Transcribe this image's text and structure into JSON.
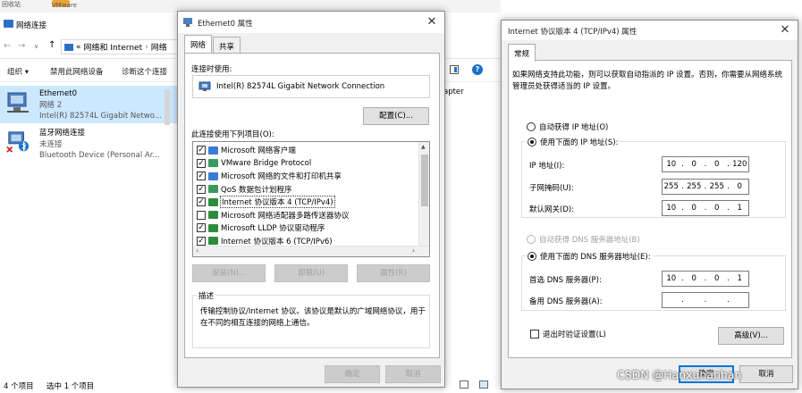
{
  "explorer": {
    "desktop_fragments": [
      "回收站",
      "VMware"
    ],
    "title": "网络连接",
    "breadcrumb": {
      "prefix": "«",
      "items": [
        "网络和 Internet",
        "网络"
      ]
    },
    "commands": [
      "组织 ▾",
      "禁用此网络设备",
      "诊断这个连接"
    ],
    "partial_text": "apter",
    "adapters": [
      {
        "name": "Ethernet0",
        "status": "网络 2",
        "device": "Intel(R) 82574L Gigabit Netwo...",
        "selected": true
      },
      {
        "name": "蓝牙网络连接",
        "status": "未连接",
        "device": "Bluetooth Device (Personal Ar...",
        "selected": false
      }
    ],
    "status_bar": {
      "count": "4 个项目",
      "selected": "选中 1 个项目"
    }
  },
  "props": {
    "title": "Ethernet0 属性",
    "tabs": [
      "网络",
      "共享"
    ],
    "connect_using_label": "连接时使用:",
    "adapter_name": "Intel(R) 82574L Gigabit Network Connection",
    "configure_button": "配置(C)...",
    "items_label": "此连接使用下列项目(O):",
    "items": [
      {
        "label": "Microsoft 网络客户端",
        "checked": true,
        "icon_color": "#3a7bd5"
      },
      {
        "label": "VMware Bridge Protocol",
        "checked": true,
        "icon_color": "#3a9a5b"
      },
      {
        "label": "Microsoft 网络的文件和打印机共享",
        "checked": true,
        "icon_color": "#3a7bd5"
      },
      {
        "label": "QoS 数据包计划程序",
        "checked": true,
        "icon_color": "#3a9a5b"
      },
      {
        "label": "Internet 协议版本 4 (TCP/IPv4)",
        "checked": true,
        "icon_color": "#2c8c3c",
        "selected": true
      },
      {
        "label": "Microsoft 网络适配器多路传送器协议",
        "checked": false,
        "icon_color": "#2c8c3c"
      },
      {
        "label": "Microsoft LLDP 协议驱动程序",
        "checked": true,
        "icon_color": "#2c8c3c"
      },
      {
        "label": "Internet 协议版本 6 (TCP/IPv6)",
        "checked": true,
        "icon_color": "#2c8c3c"
      }
    ],
    "install_button": "安装(N)...",
    "uninstall_button": "卸载(U)",
    "properties_button": "属性(R)",
    "description_caption": "描述",
    "description": "传输控制协议/Internet 协议。该协议是默认的广域网络协议，用于在不同的相互连接的网络上通信。",
    "ok_button": "确定",
    "cancel_button": "取消"
  },
  "ipv4": {
    "title": "Internet 协议版本 4 (TCP/IPv4) 属性",
    "tab": "常规",
    "intro": "如果网络支持此功能，则可以获取自动指派的 IP 设置。否则，你需要从网络系统管理员处获得适当的 IP 设置。",
    "auto_ip": "自动获得 IP 地址(O)",
    "manual_ip": "使用下面的 IP 地址(S):",
    "ip_label": "IP 地址(I):",
    "ip": [
      "10",
      "0",
      "0",
      "120"
    ],
    "mask_label": "子网掩码(U):",
    "mask": [
      "255",
      "255",
      "255",
      "0"
    ],
    "gateway_label": "默认网关(D):",
    "gateway": [
      "10",
      "0",
      "0",
      "1"
    ],
    "auto_dns": "自动获得 DNS 服务器地址(B)",
    "manual_dns": "使用下面的 DNS 服务器地址(E):",
    "pref_dns_label": "首选 DNS 服务器(P):",
    "pref_dns": [
      "10",
      "0",
      "0",
      "1"
    ],
    "alt_dns_label": "备用 DNS 服务器(A):",
    "alt_dns": [
      "",
      "",
      "",
      ""
    ],
    "validate_label": "退出时验证设置(L)",
    "advanced_button": "高级(V)...",
    "ok_button": "确定",
    "cancel_button": "取消"
  },
  "watermark": "CSDN @Hanxuhanhan",
  "colors": {
    "selection": "#cce8ff",
    "accent": "#0078d7",
    "dialog_bg": "#f0f0f0"
  }
}
